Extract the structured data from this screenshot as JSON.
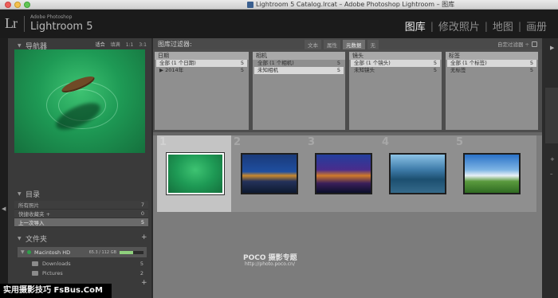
{
  "window": {
    "title": "Lightroom 5 Catalog.lrcat – Adobe Photoshop Lightroom – 图库"
  },
  "identity": {
    "logo": "Lr",
    "vendor": "Adobe Photoshop",
    "product": "Lightroom 5"
  },
  "modules": {
    "library": "图库",
    "develop": "修改照片",
    "map": "地图",
    "book": "画册"
  },
  "navigator": {
    "title": "导航器",
    "zoom": [
      "适合",
      "填满",
      "1:1",
      "3:1"
    ]
  },
  "catalog": {
    "title": "目录",
    "items": [
      {
        "label": "所有照片",
        "count": "7"
      },
      {
        "label": "快捷收藏夹 +",
        "count": "0"
      },
      {
        "label": "上一次导入",
        "count": "5"
      }
    ]
  },
  "folders": {
    "title": "文件夹",
    "drive": {
      "name": "Macintosh HD",
      "size": "65.3 / 112 GB",
      "fill": 0.58
    },
    "items": [
      {
        "label": "Downloads",
        "count": "5"
      },
      {
        "label": "Pictures",
        "count": "2"
      }
    ]
  },
  "filter": {
    "title": "图库过滤器:",
    "tabs": [
      "文本",
      "属性",
      "元数据",
      "无"
    ],
    "preset": "自定过滤器 ÷",
    "columns": [
      {
        "header": "日期",
        "rows": [
          {
            "label": "全部 (1 个日期)",
            "count": "5"
          },
          {
            "label": "▶ 2014年",
            "count": "5"
          }
        ]
      },
      {
        "header": "相机",
        "rows": [
          {
            "label": "全部 (1 个相机)",
            "count": "5"
          },
          {
            "label": "未知相机",
            "count": "5"
          }
        ]
      },
      {
        "header": "镜头",
        "rows": [
          {
            "label": "全部 (1 个镜头)",
            "count": "5"
          },
          {
            "label": "未知镜头",
            "count": "5"
          }
        ]
      },
      {
        "header": "标签",
        "rows": [
          {
            "label": "全部 (1 个标签)",
            "count": "5"
          },
          {
            "label": "无标签",
            "count": "5"
          }
        ]
      }
    ]
  },
  "grid": {
    "cells": [
      {
        "number": "1",
        "thumb": "boat-on-green-water"
      },
      {
        "number": "2",
        "thumb": "city-night-skyline"
      },
      {
        "number": "3",
        "thumb": "highway-interchange-dusk"
      },
      {
        "number": "4",
        "thumb": "karst-river-landscape"
      },
      {
        "number": "5",
        "thumb": "meadow-blue-sky"
      }
    ]
  },
  "watermark": {
    "brand": "POCO 摄影专题",
    "url": "http://photo.poco.cn/"
  },
  "banner": {
    "text": "实用摄影技巧 FsBus.CoM"
  },
  "colors": {
    "accent_selected": "#c4c4c4",
    "grid_background": "#7c7c7c",
    "drive_indicator": "#2ea14a"
  }
}
